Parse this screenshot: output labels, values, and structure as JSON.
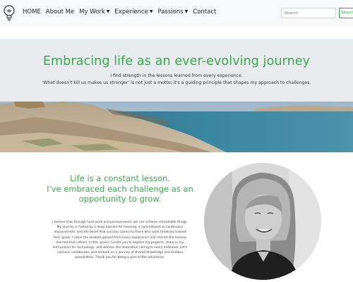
{
  "nav": {
    "items": [
      {
        "label": "HOME",
        "dropdown": false
      },
      {
        "label": "About Me",
        "dropdown": false
      },
      {
        "label": "My Work",
        "dropdown": true
      },
      {
        "label": "Experience",
        "dropdown": true
      },
      {
        "label": "Passions",
        "dropdown": true
      },
      {
        "label": "Contact",
        "dropdown": false
      }
    ],
    "search_placeholder": "Search",
    "search_button": "Search",
    "logo_icon": "lightbulb-icon"
  },
  "hero": {
    "title": "Embracing life as an ever-evolving journey",
    "line1": "I find strength in the lessons learned from every experience.",
    "line2": "'What doesn't kill us makes us stronger' is not just a motto; it's a guiding principle that shapes my approach to challenges."
  },
  "about": {
    "heading_line1": "Life is a constant lesson.",
    "heading_line2": "I've embraced each challenge as an",
    "heading_line3": "opportunity to grow.",
    "bio_lines": [
      "I believe that through hard work and perseverance, we can achieve remarkable things.",
      "My journey is fueled by a deep passion for learning, a commitment to continuous",
      "improvement, and the belief that success comes to those who work tirelessly toward",
      "their goals. I value the wisdom gained from every experience and cherish the lessons",
      "learned from others. In this space, I invite you to explore my projects, share in my",
      "enthusiasm for technology, and witness the dedication I bring to every endeavor. Let's",
      "connect, collaborate, and embark on a journey of shared knowledge and endless",
      "possibilities. Thank you for being a part of this adventure."
    ]
  },
  "colors": {
    "accent": "#3aa84d",
    "hero_bg": "#e9ecef",
    "navbar_bg": "#f8f9fa"
  }
}
